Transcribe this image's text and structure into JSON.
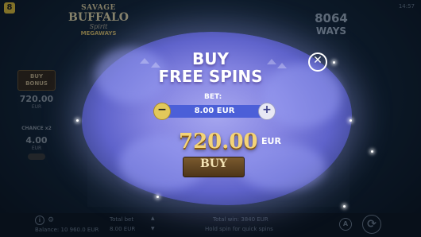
{
  "game": {
    "logo_badge": "8",
    "logo_line1": "SAVAGE",
    "logo_line2": "BUFFALO",
    "logo_line3": "Spirit",
    "logo_line4": "MEGAWAYS",
    "ways_count": "8064",
    "ways_label": "WAYS",
    "clock": "14:57"
  },
  "side_panel": {
    "buy_bonus_label": "BUY BONUS",
    "buy_bonus_value": "720.00",
    "buy_bonus_sub": "EUR",
    "chance_label": "CHANCE x2",
    "chance_value": "4.00",
    "chance_sub": "EUR"
  },
  "modal": {
    "title_line1": "BUY",
    "title_line2": "FREE SPINS",
    "bet_label": "BET:",
    "bet_value": "8.00 EUR",
    "price": "720.00",
    "currency": "EUR",
    "buy_button": "BUY",
    "close_icon": "close-icon"
  },
  "bottom_bar": {
    "balance": "Balance: 10 960.0 EUR",
    "total_bet_label": "Total bet",
    "total_bet_value": "8.00 EUR",
    "total_win": "Total win: 3840 EUR",
    "hint": "Hold spin for quick spins",
    "autoplay_icon": "A"
  },
  "colors": {
    "cloud": "#8585e2",
    "price": "#f4d478",
    "buy_button": "#5d4222",
    "bet_track": "#4b5fd8"
  }
}
